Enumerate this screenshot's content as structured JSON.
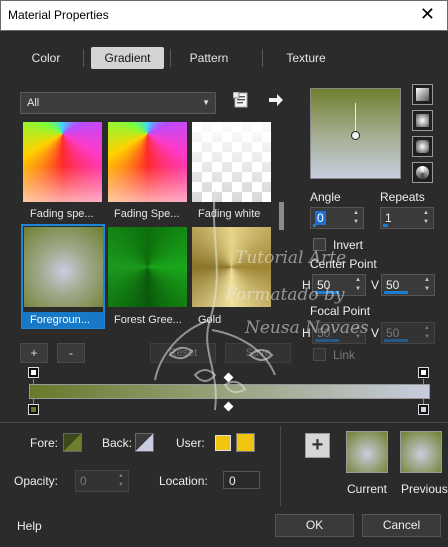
{
  "window": {
    "title": "Material Properties",
    "close_glyph": "✕"
  },
  "tabs": [
    {
      "label": "Color"
    },
    {
      "label": "Gradient"
    },
    {
      "label": "Pattern"
    },
    {
      "label": "Texture"
    }
  ],
  "category": {
    "selected": "All"
  },
  "gradients": [
    {
      "label": "Fading spe..."
    },
    {
      "label": "Fading Spe..."
    },
    {
      "label": "Fading white"
    },
    {
      "label": "Foregroun..."
    },
    {
      "label": "Forest Gree..."
    },
    {
      "label": "Gold"
    }
  ],
  "list_buttons": {
    "add": "+",
    "remove": "-",
    "reset": "Reset",
    "save": "Save"
  },
  "angle": {
    "label": "Angle",
    "value": "0"
  },
  "repeats": {
    "label": "Repeats",
    "value": "1"
  },
  "invert": {
    "label": "Invert"
  },
  "center_point": {
    "label": "Center Point",
    "h_label": "H",
    "h_value": "50",
    "v_label": "V",
    "v_value": "50"
  },
  "focal_point": {
    "label": "Focal Point",
    "h_label": "H",
    "h_value": "50",
    "v_label": "V",
    "v_value": "50"
  },
  "link": {
    "label": "Link"
  },
  "fore": {
    "label": "Fore:"
  },
  "back": {
    "label": "Back:"
  },
  "user": {
    "label": "User:"
  },
  "opacity": {
    "label": "Opacity:",
    "value": "0"
  },
  "location": {
    "label": "Location:",
    "value": "0"
  },
  "current": {
    "label": "Current"
  },
  "previous": {
    "label": "Previous"
  },
  "help": {
    "label": "Help"
  },
  "ok": {
    "label": "OK"
  },
  "cancel": {
    "label": "Cancel"
  },
  "watermark": {
    "line1": "Tutorial Arte",
    "line2": "Formatado by",
    "line3": "Neusa Novaes"
  },
  "colors": {
    "accent": "#1e86d8",
    "user_color": "#f1c40f",
    "gradient_start": "#68792a",
    "gradient_end": "#c7cdde"
  }
}
